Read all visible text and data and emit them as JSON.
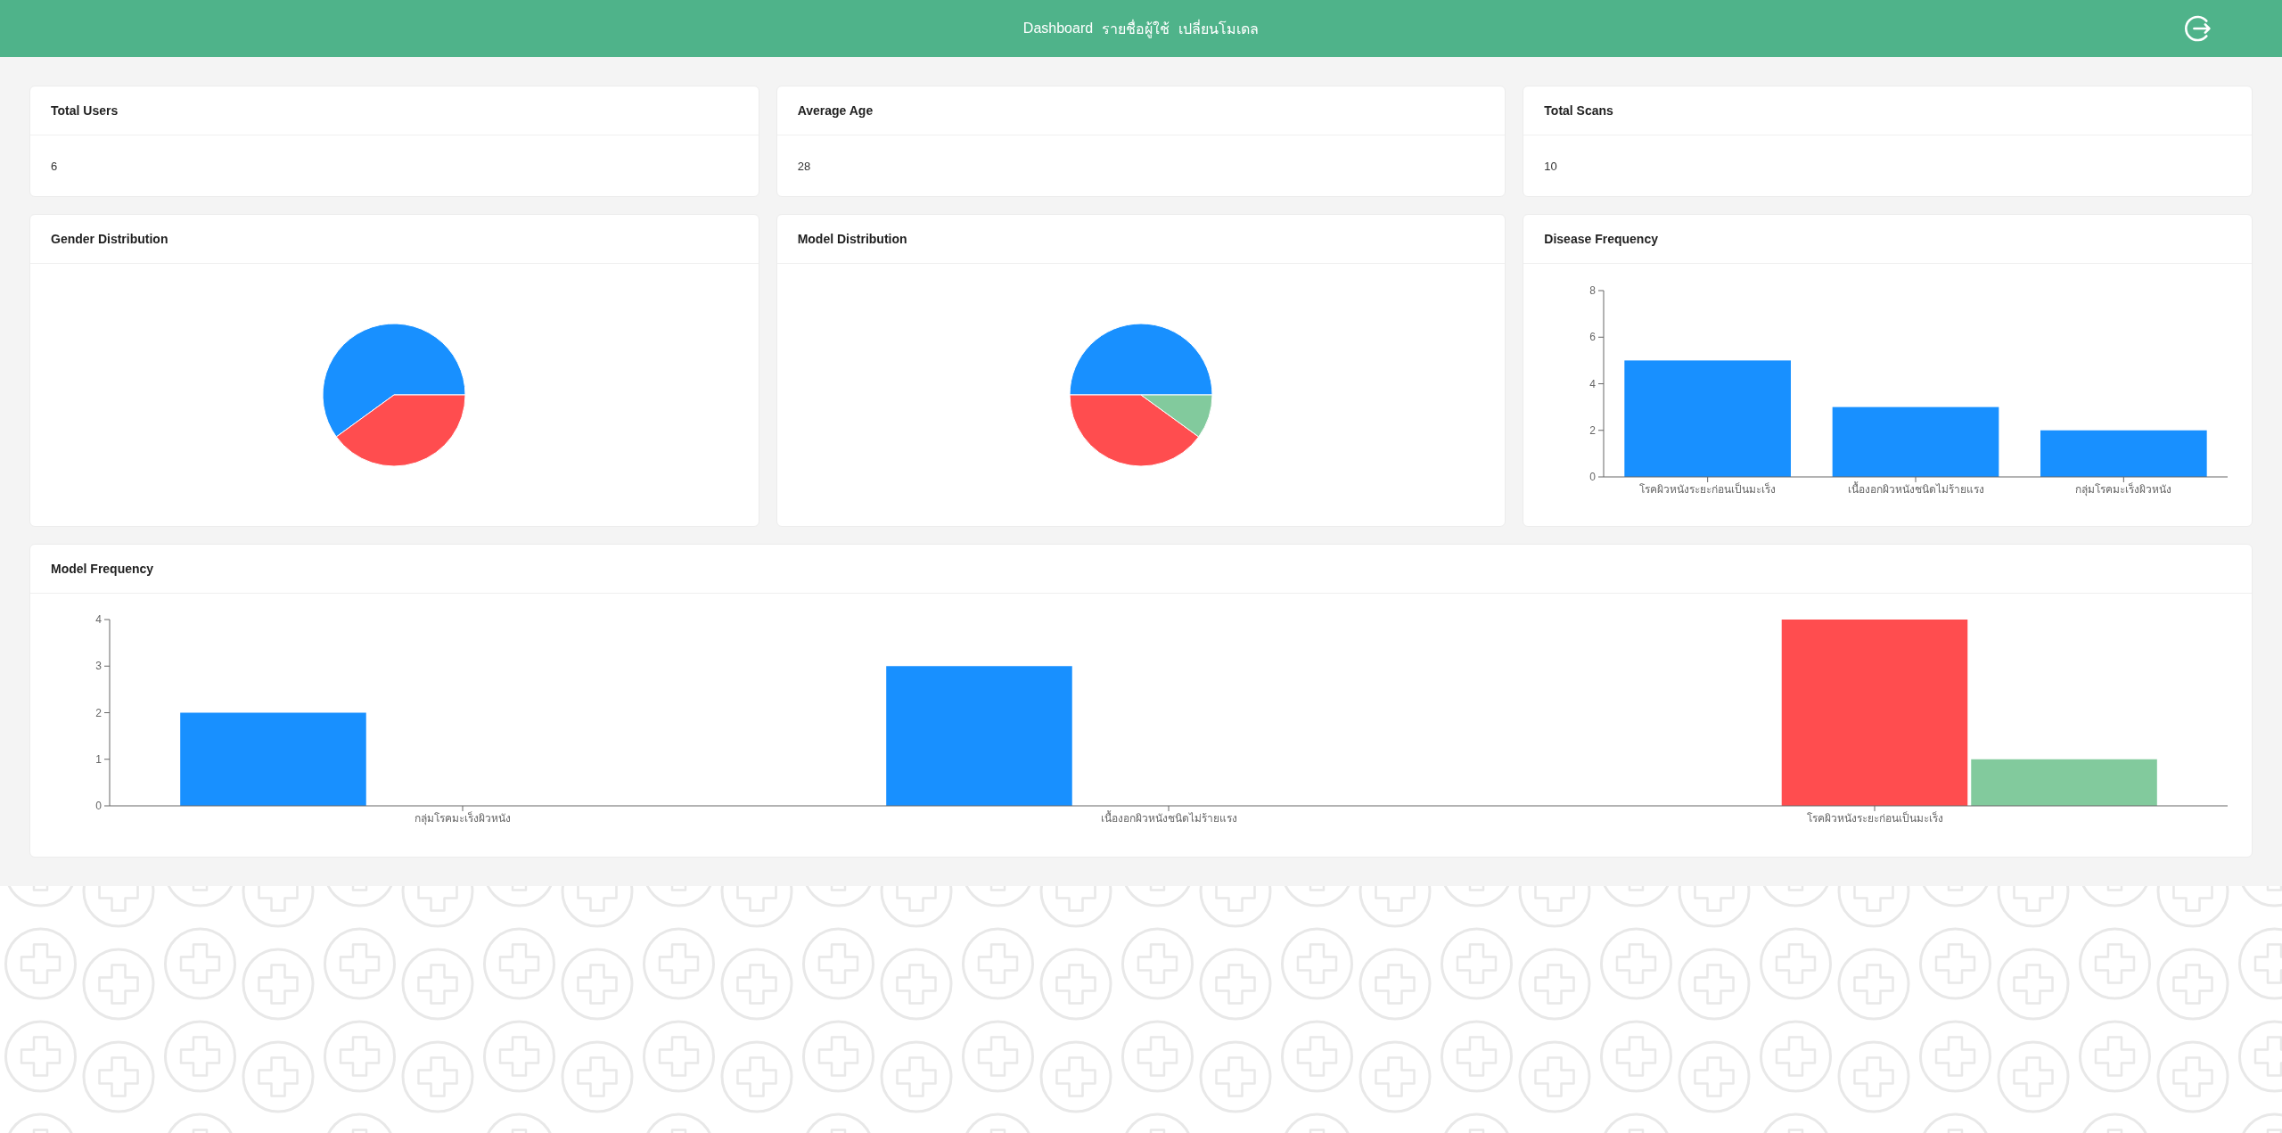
{
  "navbar": {
    "links": [
      "Dashboard",
      "รายชื่อผู้ใช้",
      "เปลี่ยนโมเดล"
    ]
  },
  "stat_cards": [
    {
      "title": "Total Users",
      "value": "6"
    },
    {
      "title": "Average Age",
      "value": "28"
    },
    {
      "title": "Total Scans",
      "value": "10"
    }
  ],
  "chart_cards": [
    {
      "title": "Gender Distribution",
      "kind": "pie"
    },
    {
      "title": "Model Distribution",
      "kind": "pie"
    },
    {
      "title": "Disease Frequency",
      "kind": "bar",
      "chart_data": {
        "type": "bar",
        "categories": [
          "โรคผิวหนังระยะก่อนเป็นมะเร็ง",
          "เนื้องอกผิวหนังชนิดไม่ร้ายแรง",
          "กลุ่มโรคมะเร็งผิวหนัง"
        ],
        "series": [
          {
            "color": "#1890ff",
            "values": [
              5,
              3,
              2
            ]
          }
        ],
        "ylim": [
          0,
          8
        ],
        "yticks": [
          0,
          2,
          4,
          6,
          8
        ]
      }
    }
  ],
  "model_frequency": {
    "title": "Model Frequency",
    "chart_data": {
      "type": "bar",
      "categories": [
        "กลุ่มโรคมะเร็งผิวหนัง",
        "เนื้องอกผิวหนังชนิดไม่ร้ายแรง",
        "โรคผิวหนังระยะก่อนเป็นมะเร็ง"
      ],
      "series": [
        {
          "color": "#1890ff",
          "values": [
            2,
            3,
            0
          ]
        },
        {
          "color": "#ff4d4f",
          "values": [
            0,
            0,
            4
          ]
        },
        {
          "color": "#82ca9d",
          "values": [
            0,
            0,
            1
          ]
        }
      ],
      "ylim": [
        0,
        4
      ],
      "yticks": [
        0,
        1,
        2,
        3,
        4
      ]
    }
  }
}
